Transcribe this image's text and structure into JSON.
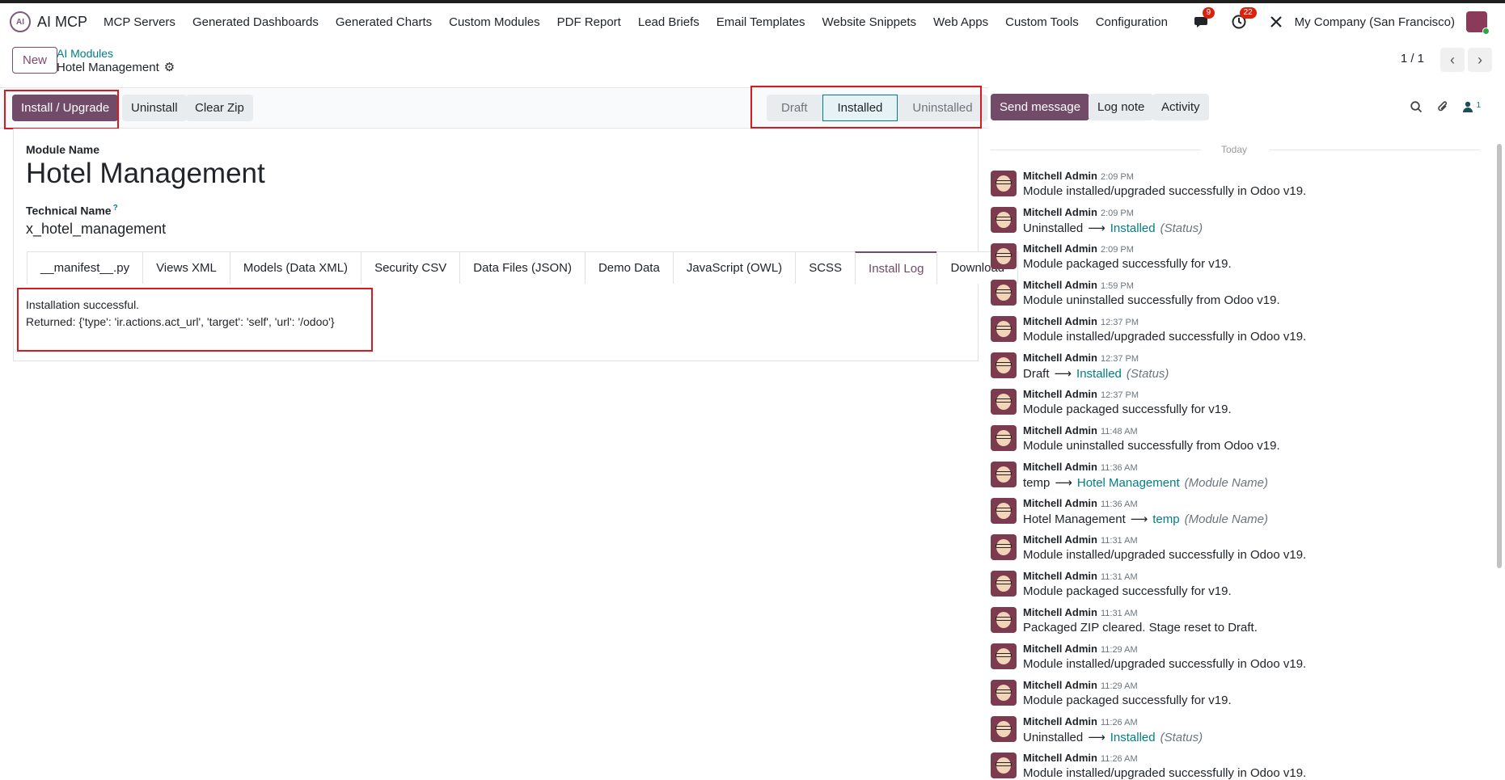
{
  "app": {
    "logo": "AI",
    "name": "AI MCP"
  },
  "nav": [
    "MCP Servers",
    "Generated Dashboards",
    "Generated Charts",
    "Custom Modules",
    "PDF Report",
    "Lead Briefs",
    "Email Templates",
    "Website Snippets",
    "Web Apps",
    "Custom Tools",
    "Configuration"
  ],
  "systray": {
    "messages_badge": "9",
    "activities_badge": "22",
    "company": "My Company (San Francisco)"
  },
  "control": {
    "new_label": "New",
    "breadcrumb_parent": "AI Modules",
    "breadcrumb_current": "Hotel Management",
    "pager": "1 / 1",
    "prev": "‹",
    "next": "›"
  },
  "actions": {
    "install": "Install / Upgrade",
    "uninstall": "Uninstall",
    "clear_zip": "Clear Zip"
  },
  "stages": [
    {
      "label": "Draft",
      "active": false
    },
    {
      "label": "Installed",
      "active": true
    },
    {
      "label": "Uninstalled",
      "active": false
    }
  ],
  "chatter_buttons": {
    "send": "Send message",
    "log": "Log note",
    "activity": "Activity",
    "followers_count": "1"
  },
  "form": {
    "module_name_label": "Module Name",
    "module_name": "Hotel Management",
    "technical_name_label": "Technical Name",
    "help": "?",
    "technical_name": "x_hotel_management",
    "tabs": [
      {
        "label": "__manifest__.py",
        "active": false
      },
      {
        "label": "Views XML",
        "active": false
      },
      {
        "label": "Models (Data XML)",
        "active": false
      },
      {
        "label": "Security CSV",
        "active": false
      },
      {
        "label": "Data Files (JSON)",
        "active": false
      },
      {
        "label": "Demo Data",
        "active": false
      },
      {
        "label": "JavaScript (OWL)",
        "active": false
      },
      {
        "label": "SCSS",
        "active": false
      },
      {
        "label": "Install Log",
        "active": true
      },
      {
        "label": "Download",
        "active": false
      }
    ],
    "log_line1": "Installation successful.",
    "log_line2": "Returned: {'type': 'ir.actions.act_url', 'target': 'self', 'url': '/odoo'}"
  },
  "chatter": {
    "today": "Today",
    "messages": [
      {
        "author": "Mitchell Admin",
        "time": "2:09 PM",
        "body": "Module installed/upgraded successfully in Odoo v19."
      },
      {
        "author": "Mitchell Admin",
        "time": "2:09 PM",
        "old": "Uninstalled",
        "new": "Installed",
        "field": "(Status)"
      },
      {
        "author": "Mitchell Admin",
        "time": "2:09 PM",
        "body": "Module packaged successfully for v19."
      },
      {
        "author": "Mitchell Admin",
        "time": "1:59 PM",
        "body": "Module uninstalled successfully from Odoo v19."
      },
      {
        "author": "Mitchell Admin",
        "time": "12:37 PM",
        "body": "Module installed/upgraded successfully in Odoo v19."
      },
      {
        "author": "Mitchell Admin",
        "time": "12:37 PM",
        "old": "Draft",
        "new": "Installed",
        "field": "(Status)"
      },
      {
        "author": "Mitchell Admin",
        "time": "12:37 PM",
        "body": "Module packaged successfully for v19."
      },
      {
        "author": "Mitchell Admin",
        "time": "11:48 AM",
        "body": "Module uninstalled successfully from Odoo v19."
      },
      {
        "author": "Mitchell Admin",
        "time": "11:36 AM",
        "old": "temp",
        "new": "Hotel Management",
        "field": "(Module Name)"
      },
      {
        "author": "Mitchell Admin",
        "time": "11:36 AM",
        "old": "Hotel Management",
        "new": "temp",
        "field": "(Module Name)"
      },
      {
        "author": "Mitchell Admin",
        "time": "11:31 AM",
        "body": "Module installed/upgraded successfully in Odoo v19."
      },
      {
        "author": "Mitchell Admin",
        "time": "11:31 AM",
        "body": "Module packaged successfully for v19."
      },
      {
        "author": "Mitchell Admin",
        "time": "11:31 AM",
        "body": "Packaged ZIP cleared. Stage reset to Draft."
      },
      {
        "author": "Mitchell Admin",
        "time": "11:29 AM",
        "body": "Module installed/upgraded successfully in Odoo v19."
      },
      {
        "author": "Mitchell Admin",
        "time": "11:29 AM",
        "body": "Module packaged successfully for v19."
      },
      {
        "author": "Mitchell Admin",
        "time": "11:26 AM",
        "old": "Uninstalled",
        "new": "Installed",
        "field": "(Status)"
      },
      {
        "author": "Mitchell Admin",
        "time": "11:26 AM",
        "body": "Module installed/upgraded successfully in Odoo v19."
      }
    ]
  },
  "colors": {
    "primary": "#714b67",
    "accent": "#017e84",
    "highlight": "#d71920"
  }
}
